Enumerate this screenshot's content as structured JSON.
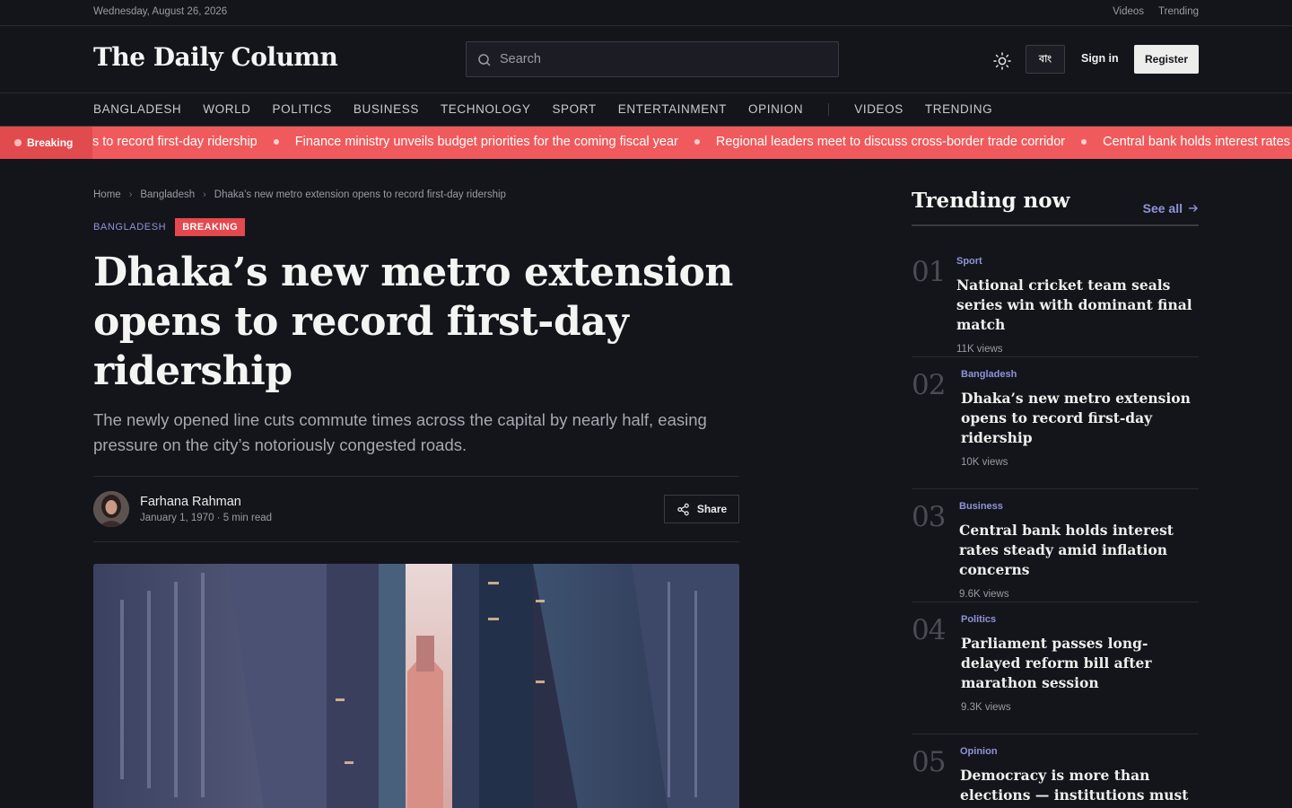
{
  "topbar": {
    "date": "Wednesday, August 26, 2026",
    "links": [
      "Videos",
      "Trending"
    ]
  },
  "header": {
    "logo": "The Daily Column",
    "search_placeholder": "Search",
    "lang_label": "বাং",
    "signin": "Sign in",
    "register": "Register"
  },
  "nav": {
    "sections": [
      "BANGLADESH",
      "WORLD",
      "POLITICS",
      "BUSINESS",
      "TECHNOLOGY",
      "SPORT",
      "ENTERTAINMENT",
      "OPINION"
    ],
    "extras": [
      "VIDEOS",
      "TRENDING"
    ]
  },
  "ticker": {
    "label": "Breaking",
    "items": [
      "s to record first-day ridership",
      "Finance ministry unveils budget priorities for the coming fiscal year",
      "Regional leaders meet to discuss cross-border trade corridor",
      "Central bank holds interest rates steady amid inflation concerns"
    ]
  },
  "article": {
    "breadcrumb": [
      "Home",
      "Bangladesh",
      "Dhaka’s new metro extension opens to record first-day ridership"
    ],
    "category": "BANGLADESH",
    "badge": "BREAKING",
    "headline": "Dhaka’s new metro extension opens to record first-day ridership",
    "deck": "The newly opened line cuts commute times across the capital by nearly half, easing pressure on the city’s notoriously congested roads.",
    "author": "Farhana Rahman",
    "meta": "January 1, 1970 · 5 min read",
    "share": "Share"
  },
  "sidebar": {
    "title": "Trending now",
    "see_all": "See all",
    "items": [
      {
        "num": "01",
        "cat": "Sport",
        "title": "National cricket team seals series win with dominant final match",
        "views": "11K views"
      },
      {
        "num": "02",
        "cat": "Bangladesh",
        "title": "Dhaka’s new metro extension opens to record first-day ridership",
        "views": "10K views"
      },
      {
        "num": "03",
        "cat": "Business",
        "title": "Central bank holds interest rates steady amid inflation concerns",
        "views": "9.6K views"
      },
      {
        "num": "04",
        "cat": "Politics",
        "title": "Parliament passes long-delayed reform bill after marathon session",
        "views": "9.3K views"
      },
      {
        "num": "05",
        "cat": "Opinion",
        "title": "Democracy is more than elections — institutions must answer too",
        "views": ""
      }
    ]
  },
  "colors": {
    "background": "#14151b",
    "accent": "#8f93d8",
    "breaking": "#f05a5c"
  }
}
